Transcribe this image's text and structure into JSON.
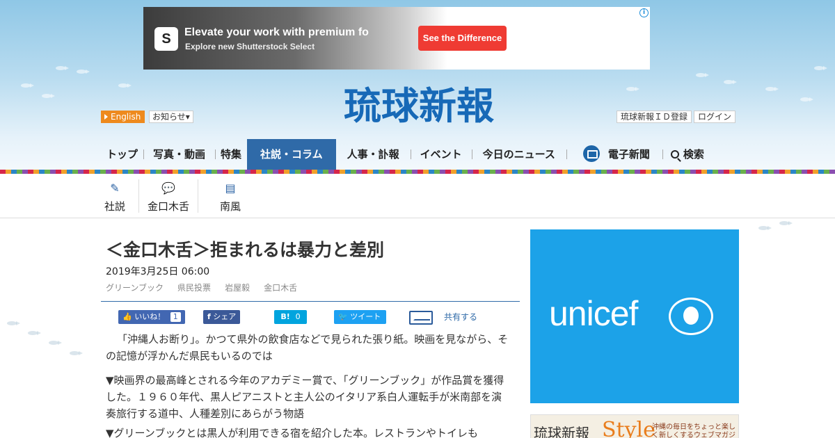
{
  "ad": {
    "logo_letter": "S",
    "headline": "Elevate your work with premium fo",
    "subline": "Explore new Shutterstock Select",
    "cta": "See the Difference",
    "info_icon": "info-icon",
    "cta_color": "#ef3b33"
  },
  "header": {
    "logo": "琉球新報",
    "english": "English",
    "notice": "お知らせ▾",
    "register": "琉球新報ＩＤ登録",
    "login": "ログイン",
    "brand_color": "#1769b7"
  },
  "nav": {
    "items": [
      "トップ",
      "写真・動画",
      "特集",
      "社説・コラム",
      "人事・訃報",
      "イベント",
      "今日のニュース",
      "電子新聞",
      "検索"
    ],
    "active": "社説・コラム",
    "active_color": "#2f6aa8"
  },
  "subnav": {
    "items": [
      {
        "label": "社説",
        "icon": "pen-icon"
      },
      {
        "label": "金口木舌",
        "icon": "speech-bubble-icon"
      },
      {
        "label": "南風",
        "icon": "message-icon"
      }
    ]
  },
  "article": {
    "title": "＜金口木舌＞拒まれるは暴力と差別",
    "date": "2019年3月25日 06:00",
    "tags": [
      "グリーンブック",
      "県民投票",
      "岩屋毅",
      "金口木舌"
    ],
    "share": {
      "like_label": "いいね！",
      "like_count": "1",
      "share_label": "シェア",
      "hatena_label": "B!",
      "hatena_count": "0",
      "tweet_label": "ツイート",
      "share_all_label": "共有する"
    },
    "paragraphs": [
      "「沖縄人お断り」。かつて県外の飲食店などで見られた張り紙。映画を見ながら、その記憶が浮かんだ県民もいるのでは",
      "▼映画界の最高峰とされる今年のアカデミー賞で、「グリーンブック」が作品賞を獲得した。１９６０年代、黒人ピアニストと主人公のイタリア系白人運転手が米南部を演奏旅行する道中、人種差別にあらがう物語",
      "▼グリーンブックとは黒人が利用できる宿を紹介した本。レストランやトイレも"
    ]
  },
  "sidebar": {
    "unicef_label": "unicef",
    "unicef_color": "#1ca2e8",
    "style_banner": {
      "left": "琉球新報",
      "word": "Style",
      "sub": "沖縄の毎日をちょっと楽しく新しくするウェブマガジン"
    }
  }
}
